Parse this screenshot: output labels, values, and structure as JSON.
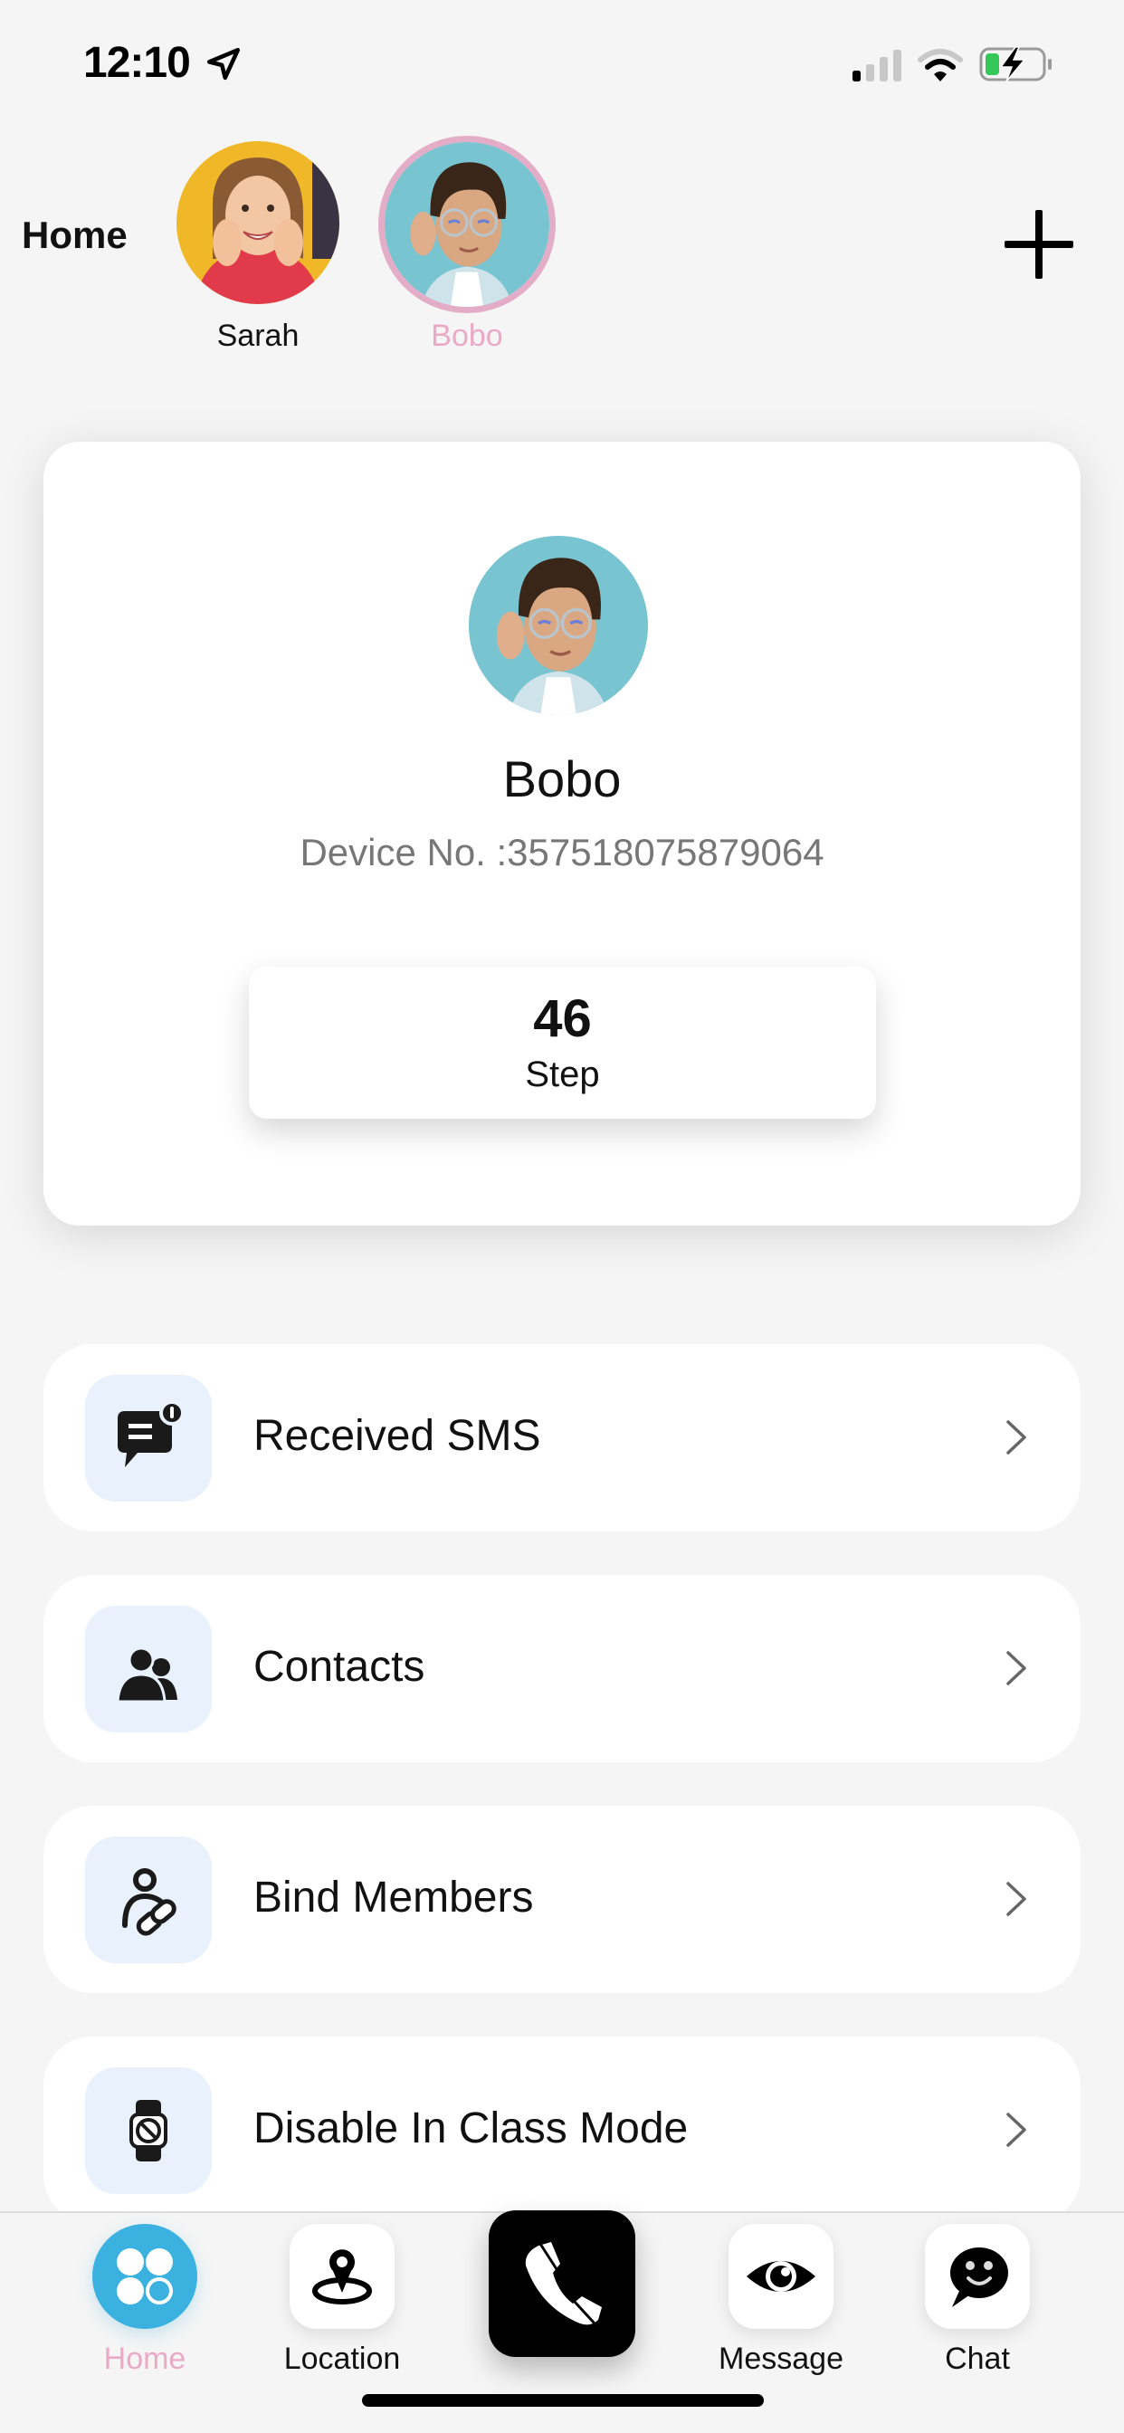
{
  "status_bar": {
    "time": "12:10",
    "location_services": true,
    "signal_bars_active": 1,
    "signal_bars_total": 4,
    "wifi": "connected",
    "battery_charging": true,
    "battery_level": 0.25,
    "battery_color": "#34c759"
  },
  "header": {
    "title": "Home",
    "kids": [
      {
        "name": "Sarah",
        "selected": false
      },
      {
        "name": "Bobo",
        "selected": true
      }
    ],
    "add_button": "add-icon",
    "selected_color": "#eaaac5"
  },
  "profile": {
    "name": "Bobo",
    "device_no": "Device No. :357518075879064",
    "steps": {
      "value": "46",
      "label": "Step"
    }
  },
  "menu": [
    {
      "label": "Received SMS",
      "icon": "sms-alert-icon"
    },
    {
      "label": "Contacts",
      "icon": "contacts-icon"
    },
    {
      "label": "Bind Members",
      "icon": "bind-members-icon"
    },
    {
      "label": "Disable In Class Mode",
      "icon": "watch-disabled-icon"
    }
  ],
  "tab_bar": {
    "tabs": [
      {
        "label": "Home",
        "icon": "home-grid-icon",
        "active": true
      },
      {
        "label": "Location",
        "icon": "location-pin-icon",
        "active": false
      },
      {
        "label": "",
        "icon": "phone-icon",
        "active": false
      },
      {
        "label": "Message",
        "icon": "eye-icon",
        "active": false
      },
      {
        "label": "Chat",
        "icon": "chat-smile-icon",
        "active": false
      }
    ],
    "accent": "#3bb1e0"
  }
}
